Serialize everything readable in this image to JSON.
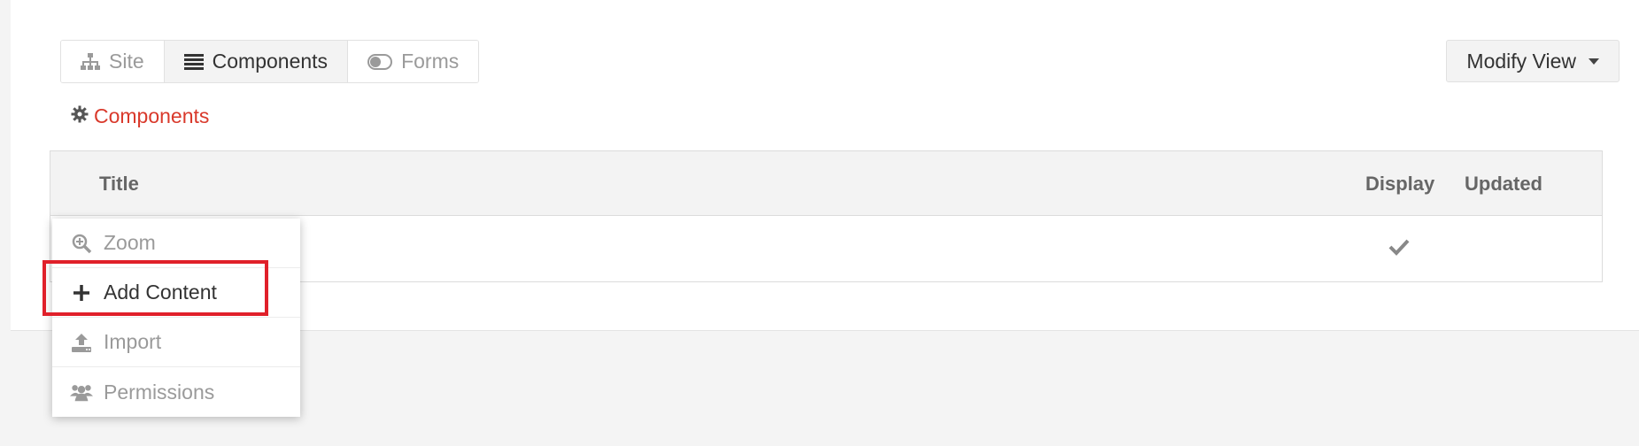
{
  "tabs": [
    {
      "label": "Site",
      "icon": "sitemap-icon"
    },
    {
      "label": "Components",
      "icon": "list-icon"
    },
    {
      "label": "Forms",
      "icon": "toggle-icon"
    }
  ],
  "modify_view": {
    "label": "Modify View"
  },
  "breadcrumb": {
    "label": "Components",
    "icon": "gear-icon"
  },
  "table": {
    "columns": [
      "Title",
      "Display",
      "Updated"
    ],
    "rows": [
      {
        "display": "check-icon",
        "updated": ""
      }
    ]
  },
  "context_menu": {
    "items": [
      {
        "label": "Zoom",
        "icon": "zoom-in-icon"
      },
      {
        "label": "Add Content",
        "icon": "plus-icon"
      },
      {
        "label": "Import",
        "icon": "upload-icon"
      },
      {
        "label": "Permissions",
        "icon": "users-icon"
      }
    ]
  },
  "colors": {
    "accent": "#d9392b",
    "highlight": "#e0202a"
  }
}
